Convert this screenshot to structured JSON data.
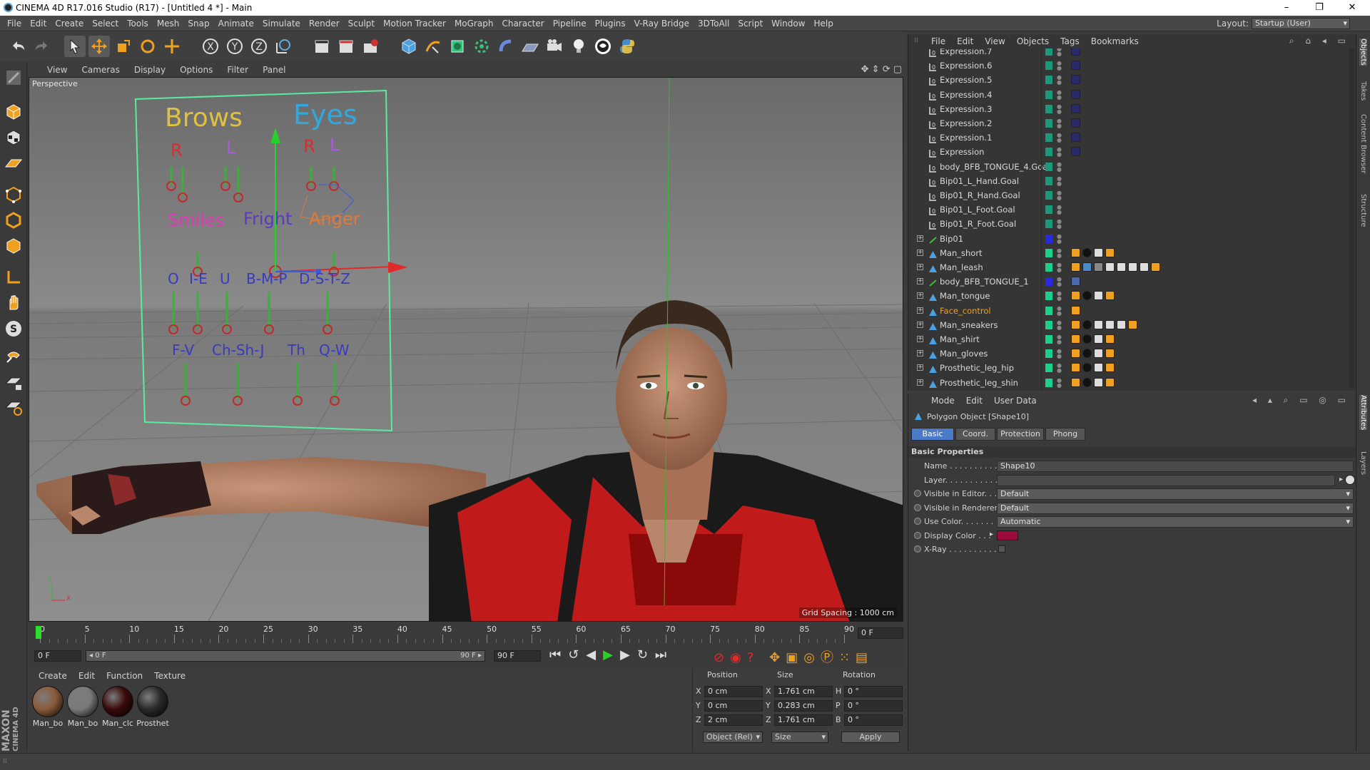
{
  "window": {
    "title": "CINEMA 4D R17.016 Studio (R17) - [Untitled 4 *] - Main",
    "minimize": "–",
    "restore": "❐",
    "close": "✕"
  },
  "menubar": {
    "items": [
      "File",
      "Edit",
      "Create",
      "Select",
      "Tools",
      "Mesh",
      "Snap",
      "Animate",
      "Simulate",
      "Render",
      "Sculpt",
      "Motion Tracker",
      "MoGraph",
      "Character",
      "Pipeline",
      "Plugins",
      "V-Ray Bridge",
      "3DToAll",
      "Script",
      "Window",
      "Help"
    ],
    "layout_label": "Layout:",
    "layout_value": "Startup (User)"
  },
  "viewport": {
    "menu": [
      "View",
      "Cameras",
      "Display",
      "Options",
      "Filter",
      "Panel"
    ],
    "label": "Perspective",
    "grid_spacing": "Grid Spacing : 1000 cm",
    "face_rig": {
      "brows": "Brows",
      "eyes": "Eyes",
      "r1": "R",
      "l1": "L",
      "r2": "R",
      "l2": "L",
      "smiles": "Smiles",
      "fright": "Fright",
      "anger": "Anger",
      "o": "O",
      "ie": "I-E",
      "u": "U",
      "bmp": "B-M-P",
      "dstz": "D-S-T-Z",
      "fv": "F-V",
      "chshj": "Ch-Sh-J",
      "th": "Th",
      "qw": "Q-W"
    },
    "axis_y": "Y",
    "axis_x": "X"
  },
  "timeline": {
    "ticks": [
      "0",
      "5",
      "10",
      "15",
      "20",
      "25",
      "30",
      "35",
      "40",
      "45",
      "50",
      "55",
      "60",
      "65",
      "70",
      "75",
      "80",
      "85",
      "90"
    ],
    "current_frame": "0 F"
  },
  "transport": {
    "start_field": "0 F",
    "range_start": "◂ 0 F",
    "range_end": "90 F ▸",
    "end_field": "90 F"
  },
  "material_manager": {
    "menu": [
      "Create",
      "Edit",
      "Function",
      "Texture"
    ],
    "materials": [
      {
        "label": "Man_bo",
        "color": "#8a5a3a"
      },
      {
        "label": "Man_bo",
        "color": "#7a7a7a"
      },
      {
        "label": "Man_clc",
        "color": "#3a0a0a"
      },
      {
        "label": "Prosthet",
        "color": "#2a2a2a"
      }
    ],
    "brand1": "MAXON",
    "brand2": "CINEMA 4D"
  },
  "coords": {
    "headers": [
      "Position",
      "Size",
      "Rotation"
    ],
    "rows": [
      {
        "axis": "X",
        "pos": "0 cm",
        "saxis": "X",
        "size": "1.761 cm",
        "raxis": "H",
        "rot": "0 °"
      },
      {
        "axis": "Y",
        "pos": "0 cm",
        "saxis": "Y",
        "size": "0.283 cm",
        "raxis": "P",
        "rot": "0 °"
      },
      {
        "axis": "Z",
        "pos": "2 cm",
        "saxis": "Z",
        "size": "1.761 cm",
        "raxis": "B",
        "rot": "0 °"
      }
    ],
    "mode_select": "Object (Rel)",
    "size_select": "Size",
    "apply": "Apply"
  },
  "object_manager": {
    "menu": [
      "File",
      "Edit",
      "View",
      "Objects",
      "Tags",
      "Bookmarks"
    ],
    "objects": [
      {
        "name": "Expression.7",
        "kind": "null",
        "expand": false,
        "layer": "#1a9a7a",
        "tags": "xp"
      },
      {
        "name": "Expression.6",
        "kind": "null",
        "expand": false,
        "layer": "#1a9a7a",
        "tags": "xp"
      },
      {
        "name": "Expression.5",
        "kind": "null",
        "expand": false,
        "layer": "#1a9a7a",
        "tags": "xp"
      },
      {
        "name": "Expression.4",
        "kind": "null",
        "expand": false,
        "layer": "#1a9a7a",
        "tags": "xp"
      },
      {
        "name": "Expression.3",
        "kind": "null",
        "expand": false,
        "layer": "#1a9a7a",
        "tags": "xp"
      },
      {
        "name": "Expression.2",
        "kind": "null",
        "expand": false,
        "layer": "#1a9a7a",
        "tags": "xp"
      },
      {
        "name": "Expression.1",
        "kind": "null",
        "expand": false,
        "layer": "#1a9a7a",
        "tags": "xp"
      },
      {
        "name": "Expression",
        "kind": "null",
        "expand": false,
        "layer": "#1a9a7a",
        "tags": "xp"
      },
      {
        "name": "body_BFB_TONGUE_4.Goal",
        "kind": "null",
        "expand": false,
        "layer": "#1a9a7a",
        "tags": ""
      },
      {
        "name": "Bip01_L_Hand.Goal",
        "kind": "null",
        "expand": false,
        "layer": "#1a9a7a",
        "tags": ""
      },
      {
        "name": "Bip01_R_Hand.Goal",
        "kind": "null",
        "expand": false,
        "layer": "#1a9a7a",
        "tags": ""
      },
      {
        "name": "Bip01_L_Foot.Goal",
        "kind": "null",
        "expand": false,
        "layer": "#1a9a7a",
        "tags": ""
      },
      {
        "name": "Bip01_R_Foot.Goal",
        "kind": "null",
        "expand": false,
        "layer": "#1a9a7a",
        "tags": ""
      },
      {
        "name": "Bip01",
        "kind": "bone",
        "expand": true,
        "layer": "#2a2ae0",
        "tags": ""
      },
      {
        "name": "Man_short",
        "kind": "poly",
        "expand": true,
        "layer": "#1ad08a",
        "tags": "mat3"
      },
      {
        "name": "Man_leash",
        "kind": "poly",
        "expand": true,
        "layer": "#1ad08a",
        "tags": "mat6"
      },
      {
        "name": "body_BFB_TONGUE_1",
        "kind": "bone",
        "expand": true,
        "layer": "#2a2ae0",
        "tags": "ik"
      },
      {
        "name": "Man_tongue",
        "kind": "poly",
        "expand": true,
        "layer": "#1ad08a",
        "tags": "mat3"
      },
      {
        "name": "Face_control",
        "kind": "poly",
        "expand": true,
        "layer": "#1ad08a",
        "tags": "one",
        "orange": true
      },
      {
        "name": "Man_sneakers",
        "kind": "poly",
        "expand": true,
        "layer": "#1ad08a",
        "tags": "mat5"
      },
      {
        "name": "Man_shirt",
        "kind": "poly",
        "expand": true,
        "layer": "#1ad08a",
        "tags": "mat3"
      },
      {
        "name": "Man_gloves",
        "kind": "poly",
        "expand": true,
        "layer": "#1ad08a",
        "tags": "mat3"
      },
      {
        "name": "Prosthetic_leg_hip",
        "kind": "poly",
        "expand": true,
        "layer": "#1ad08a",
        "tags": "mat3"
      },
      {
        "name": "Prosthetic_leg_shin",
        "kind": "poly",
        "expand": true,
        "layer": "#1ad08a",
        "tags": "mat3"
      }
    ]
  },
  "attributes": {
    "menu": [
      "Mode",
      "Edit",
      "User Data"
    ],
    "object_title": "Polygon Object [Shape10]",
    "tabs": [
      "Basic",
      "Coord.",
      "Protection",
      "Phong"
    ],
    "section": "Basic Properties",
    "fields": [
      {
        "label": "Name . . . . . . . . . . . .",
        "value": "Shape10",
        "kind": "text",
        "radio": false
      },
      {
        "label": "Layer. . . . . . . . . . . .",
        "value": "",
        "kind": "text",
        "radio": false
      },
      {
        "label": "Visible in Editor. . .",
        "value": "Default",
        "kind": "select",
        "radio": true
      },
      {
        "label": "Visible in Renderer",
        "value": "Default",
        "kind": "select",
        "radio": true
      },
      {
        "label": "Use Color. . . . . . . .",
        "value": "Automatic",
        "kind": "select",
        "radio": true
      },
      {
        "label": "Display Color . . .",
        "value": "",
        "kind": "color",
        "radio": true
      },
      {
        "label": "X-Ray . . . . . . . . . . .",
        "value": "",
        "kind": "check",
        "radio": true
      }
    ],
    "display_color": "#9a0a3a"
  },
  "side_tabs": [
    "Objects",
    "Takes",
    "Content Browser",
    "Structure"
  ],
  "side_tabs_lower": [
    "Attributes",
    "Layers"
  ]
}
